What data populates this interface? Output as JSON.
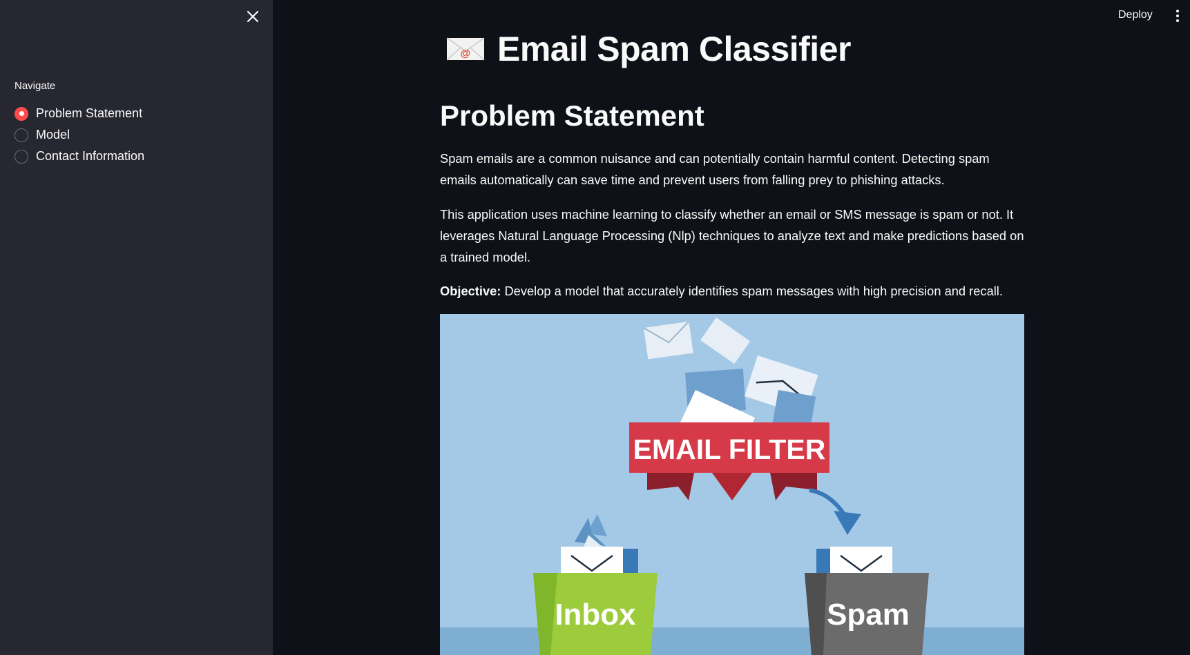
{
  "sidebar": {
    "nav_label": "Navigate",
    "options": [
      {
        "label": "Problem Statement",
        "selected": true
      },
      {
        "label": "Model",
        "selected": false
      },
      {
        "label": "Contact Information",
        "selected": false
      }
    ],
    "close_icon": "close-icon"
  },
  "header": {
    "deploy_label": "Deploy",
    "menu_icon": "more-vertical-icon"
  },
  "main": {
    "title": "Email Spam Classifier",
    "title_icon": "envelope-icon",
    "section_heading": "Problem Statement",
    "paragraph1": "Spam emails are a common nuisance and can potentially contain harmful content. Detecting spam emails automatically can save time and prevent users from falling prey to phishing attacks.",
    "paragraph2": "This application uses machine learning to classify whether an email or SMS message is spam or not. It leverages Natural Language Processing (Nlp) techniques to analyze text and make predictions based on a trained model.",
    "objective_label": "Objective:",
    "objective_text": " Develop a model that accurately identifies spam messages with high precision and recall.",
    "image": {
      "banner_text": "EMAIL FILTER",
      "inbox_label": "Inbox",
      "spam_label": "Spam"
    }
  },
  "colors": {
    "background": "#0e1117",
    "sidebar": "#262730",
    "accent": "#ff4b4b",
    "text": "#fafafa",
    "image_bg": "#a4c9e7",
    "banner_red": "#d63a48",
    "inbox_green": "#9ccc3c",
    "spam_gray": "#6b6b6b"
  }
}
